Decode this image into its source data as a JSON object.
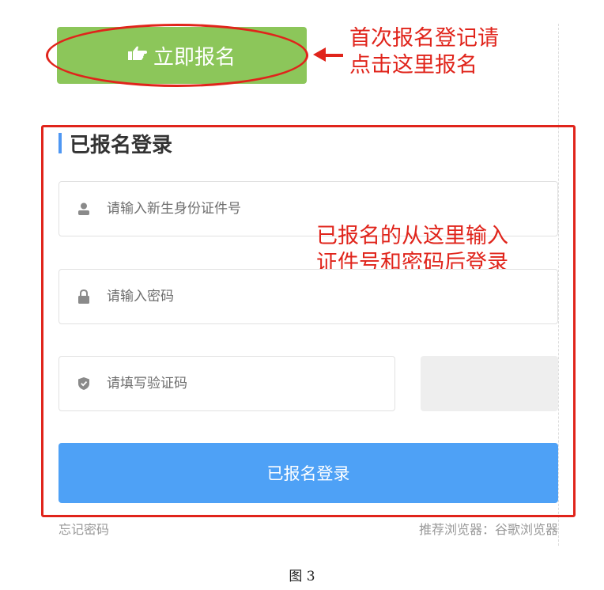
{
  "signup": {
    "label": "立即报名"
  },
  "annotations": {
    "signup_note": "首次报名登记请\n点击这里报名",
    "login_note": "已报名的从这里输入\n证件号和密码后登录"
  },
  "login_section": {
    "title": "已报名登录",
    "id_placeholder": "请输入新生身份证件号",
    "password_placeholder": "请输入密码",
    "captcha_placeholder": "请填写验证码",
    "submit_label": "已报名登录",
    "forgot_label": "忘记密码",
    "browser_hint": "推荐浏览器：谷歌浏览器"
  },
  "caption": "图 3",
  "colors": {
    "signup_green": "#8cc65a",
    "primary_blue": "#4ea1f6",
    "annotation_red": "#e0241b"
  }
}
